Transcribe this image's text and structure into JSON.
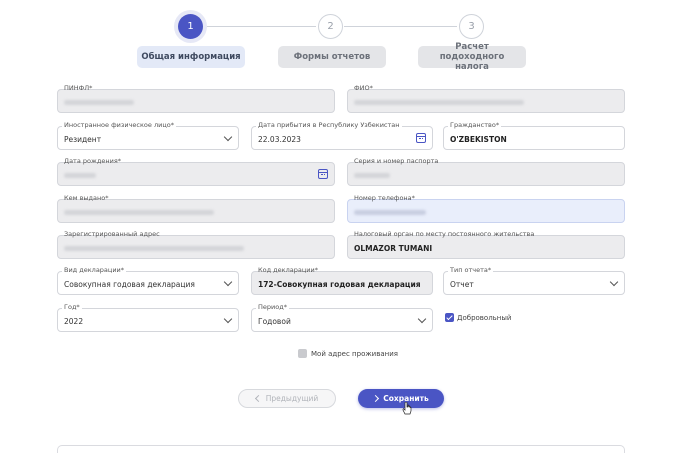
{
  "stepper": {
    "steps": [
      {
        "number": "1",
        "label": "Общая информация",
        "state": "active"
      },
      {
        "number": "2",
        "label": "Формы отчетов",
        "state": "inactive"
      },
      {
        "number": "3",
        "label": "Расчет подоходного налога",
        "state": "inactive"
      }
    ]
  },
  "form": {
    "pinfl": {
      "label": "ПИНФЛ*",
      "value_hidden": true
    },
    "fio": {
      "label": "ФИО*",
      "value_hidden": true
    },
    "foreign_person": {
      "label": "Иностранное физическое лицо*",
      "value": "Резидент"
    },
    "arrival_date": {
      "label": "Дата прибытия в Республику Узбекистан",
      "value": "22.03.2023"
    },
    "citizenship": {
      "label": "Гражданство*",
      "value": "O'ZBEKISTON"
    },
    "birth_date": {
      "label": "Дата рождения*",
      "value_hidden": true
    },
    "passport": {
      "label": "Серия и номер паспорта",
      "value_hidden": true
    },
    "issued_by": {
      "label": "Кем выдано*",
      "value_hidden": true
    },
    "phone": {
      "label": "Номер телефона*",
      "value_hidden": true
    },
    "address": {
      "label": "Зарегистрированный адрес",
      "value_hidden": true
    },
    "tax_authority": {
      "label": "Налоговый орган по месту постоянного жительства",
      "value": "OLMAZOR TUMANI"
    },
    "declaration_type": {
      "label": "Вид декларации*",
      "value": "Совокупная годовая декларация"
    },
    "declaration_code": {
      "label": "Код декларации*",
      "value": "172-Совокупная годовая декларация"
    },
    "report_type": {
      "label": "Тип отчета*",
      "value": "Отчет"
    },
    "year": {
      "label": "Год*",
      "value": "2022"
    },
    "period": {
      "label": "Период*",
      "value": "Годовой"
    },
    "voluntary": {
      "label": "Добровольный",
      "checked": true
    },
    "my_address": {
      "label": "Мой адрес проживания",
      "checked": false
    }
  },
  "buttons": {
    "prev_label": "Предыдущий",
    "save_label": "Сохранить"
  },
  "colors": {
    "accent": "#4a55c4",
    "readonly_bg": "#ececee",
    "focus_bg": "#e9eefb"
  }
}
